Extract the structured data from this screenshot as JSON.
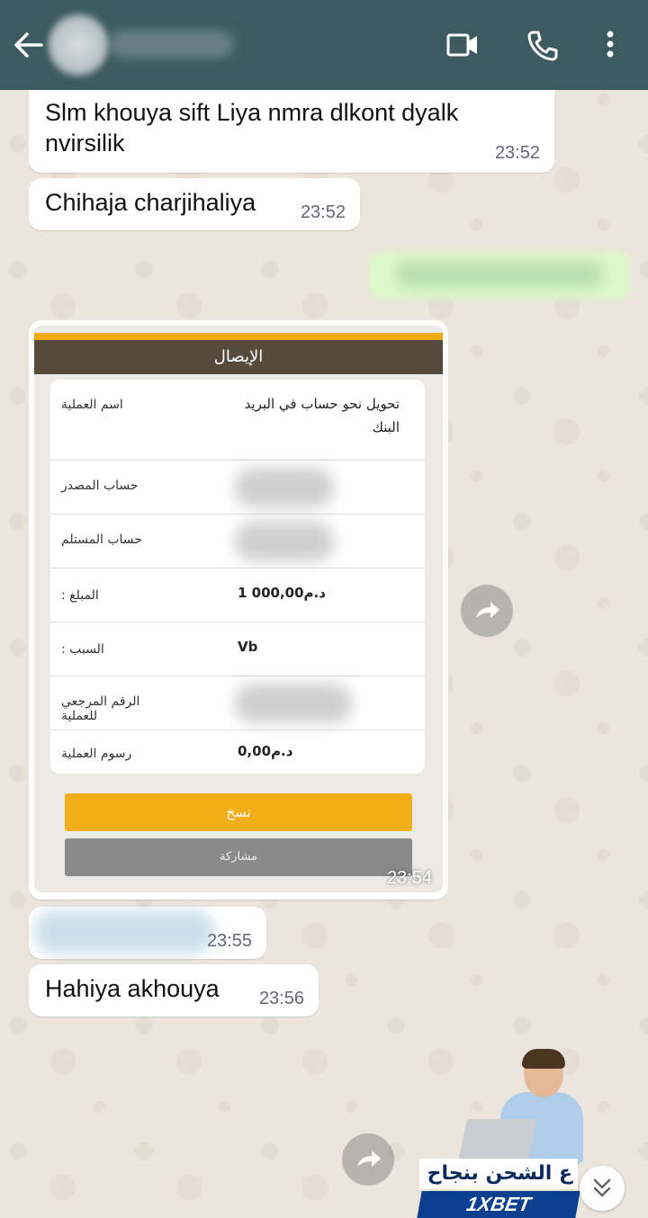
{
  "header": {
    "contact_name_hidden": true
  },
  "messages": [
    {
      "id": "m1",
      "text": "Slm khouya sift Liya nmra dlkont dyalk nvirsilik",
      "time": "23:52",
      "direction": "incoming"
    },
    {
      "id": "m2",
      "text": "Chihaja charjihaliya",
      "time": "23:52",
      "direction": "incoming"
    },
    {
      "id": "m3",
      "direction": "outgoing",
      "blurred": true
    },
    {
      "id": "m4",
      "type": "image",
      "time": "23:54",
      "direction": "incoming"
    },
    {
      "id": "m5",
      "direction": "incoming",
      "blurred": true,
      "time": "23:55"
    },
    {
      "id": "m6",
      "text": "Hahiya akhouya",
      "time": "23:56",
      "direction": "incoming"
    }
  ],
  "receipt": {
    "title": "الإيصال",
    "rows": [
      {
        "label": "اسم العملية",
        "value": "تحويل نحو حساب في البريد البنك"
      },
      {
        "label": "حساب المصدر",
        "value": null
      },
      {
        "label": "حساب المستلم",
        "value": null
      },
      {
        "label": "المبلغ :",
        "value": "1 000,00د.م"
      },
      {
        "label": "السبب :",
        "value": "Vb"
      },
      {
        "label": "الرقم المرجعي للعملية",
        "value": null
      },
      {
        "label": "رسوم العملية",
        "value": "0,00د.م"
      }
    ],
    "copy_button": "نسخ",
    "share_button": "مشاركة"
  },
  "ad": {
    "arabic_text": "ع الشحن بنجاح –",
    "brand": "1XBET"
  },
  "colors": {
    "header": "#3c5a5f",
    "receipt_accent": "#f2ae16",
    "receipt_title_bg": "#554a3c",
    "outgoing_bubble": "#dcf8c6"
  }
}
